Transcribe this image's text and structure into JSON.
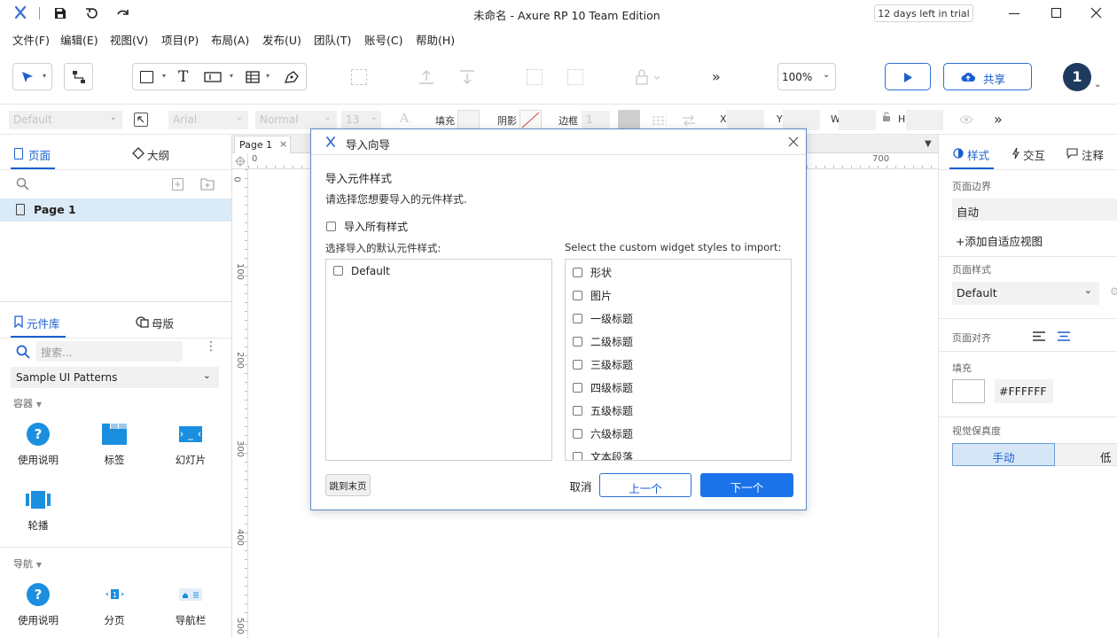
{
  "app": {
    "window_title": "未命名 - Axure RP 10 Team Edition",
    "trial_badge": "12 days left in trial"
  },
  "menu": [
    "文件(F)",
    "编辑(E)",
    "视图(V)",
    "项目(P)",
    "布局(A)",
    "发布(U)",
    "团队(T)",
    "账号(C)",
    "帮助(H)"
  ],
  "toolbar": {
    "zoom": "100%",
    "share_label": "共享",
    "avatar_initial": "1"
  },
  "propbar": {
    "style_select": "Default",
    "font_select": "Arial",
    "weight_select": "Normal",
    "size_select": "13",
    "fill_label": "填充",
    "shadow_label": "阴影",
    "border_label": "边框",
    "border_value": "1",
    "x_label": "X",
    "y_label": "Y",
    "w_label": "W",
    "h_label": "H"
  },
  "pages_panel": {
    "tab_pages": "页面",
    "tab_outline": "大纲",
    "pages": [
      "Page 1"
    ]
  },
  "library_panel": {
    "tab_library": "元件库",
    "tab_masters": "母版",
    "search_placeholder": "搜索...",
    "library_select": "Sample UI Patterns",
    "section_containers": "容器",
    "containers": [
      "使用说明",
      "标签",
      "幻灯片",
      "轮播"
    ],
    "section_nav": "导航",
    "nav_items": [
      "使用说明",
      "分页",
      "导航栏"
    ]
  },
  "canvas": {
    "tab_label": "Page 1",
    "ruler_top": [
      "0",
      "700"
    ],
    "ruler_left": [
      "0",
      "100",
      "200",
      "300",
      "400",
      "500"
    ]
  },
  "right_panel": {
    "tab_style": "样式",
    "tab_interact": "交互",
    "tab_notes": "注释",
    "page_dimension_label": "页面边界",
    "page_dimension_value": "自动",
    "add_adaptive_view": "添加自适应视图",
    "page_style_label": "页面样式",
    "page_style_value": "Default",
    "page_align_label": "页面对齐",
    "fill_label": "填充",
    "fill_value": "#FFFFFF",
    "fidelity_label": "视觉保真度",
    "fidelity_options": [
      "手动",
      "低"
    ]
  },
  "dialog": {
    "title": "导入向导",
    "heading": "导入元件样式",
    "subheading": "请选择您想要导入的元件样式.",
    "import_all_label": "导入所有样式",
    "default_styles_label": "选择导入的默认元件样式:",
    "default_styles": [
      "Default"
    ],
    "custom_styles_label": "Select the custom widget styles to import:",
    "custom_styles": [
      "形状",
      "图片",
      "一级标题",
      "二级标题",
      "三级标题",
      "四级标题",
      "五级标题",
      "六级标题",
      "文本段落"
    ],
    "skip_button": "跳到末页",
    "cancel_button": "取消",
    "prev_button": "上一个",
    "next_button": "下一个"
  },
  "colors": {
    "accent": "#1a73e8",
    "avatar": "#1e3a5f",
    "selected_page_bg": "#dbeaf7",
    "fidelity_selected_bg": "#d6e6f7"
  }
}
